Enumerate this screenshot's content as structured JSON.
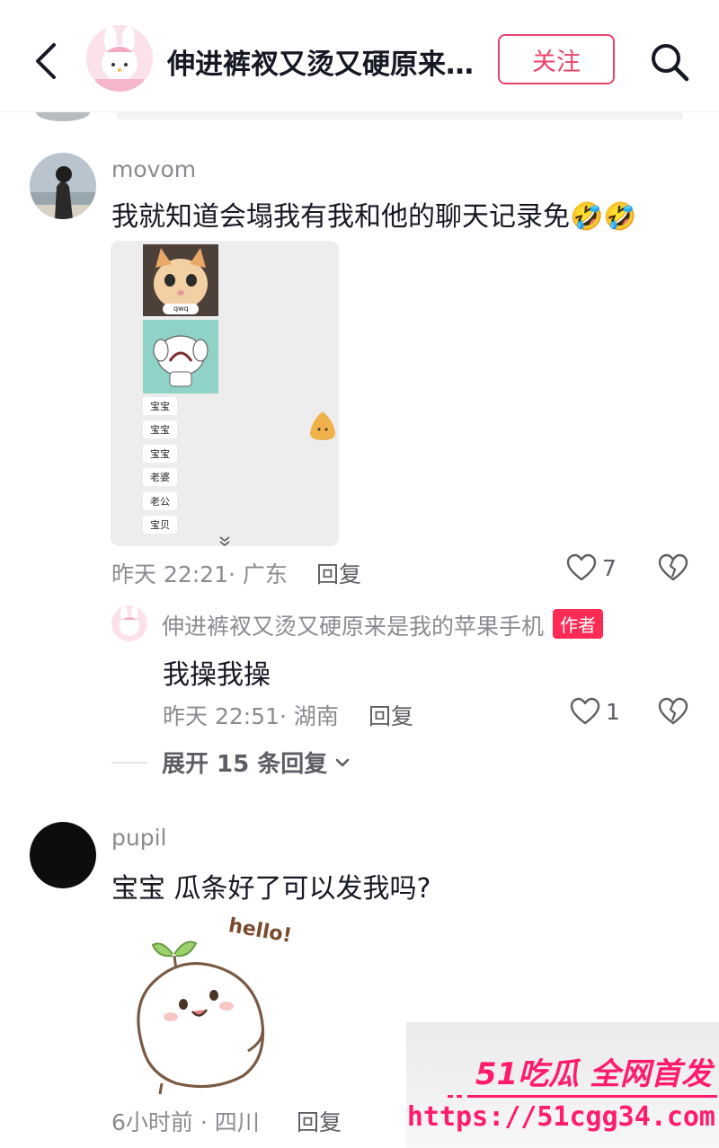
{
  "header": {
    "title": "伸进裤衩又烫又硬原来是...",
    "follow_label": "关注"
  },
  "comments": [
    {
      "username": "movom",
      "text": "我就知道会塌我有我和他的聊天记录免",
      "emoji": "🤣🤣",
      "image": {
        "sticker_caption": "qwq",
        "messages": [
          "宝宝",
          "宝宝",
          "宝宝",
          "老婆",
          "老公",
          "宝贝"
        ]
      },
      "meta": "昨天 22:21· 广东",
      "reply_label": "回复",
      "likes": "7",
      "replies": [
        {
          "username": "伸进裤衩又烫又硬原来是我的苹果手机",
          "badge": "作者",
          "text": "我操我操",
          "meta": "昨天 22:51· 湖南",
          "reply_label": "回复",
          "likes": "1"
        }
      ],
      "expand_label": "展开 15 条回复"
    },
    {
      "username": "pupil",
      "text": "宝宝 瓜条好了可以发我吗?",
      "sticker_text": "hello!",
      "meta": "6小时前 · 四川",
      "reply_label": "回复"
    }
  ],
  "watermark": {
    "title": "51吃瓜 全网首发",
    "url": "https://51cgg34.com"
  },
  "colors": {
    "accent": "#fe2c55",
    "follow": "#e8456b",
    "watermark": "#ff1c6e"
  }
}
